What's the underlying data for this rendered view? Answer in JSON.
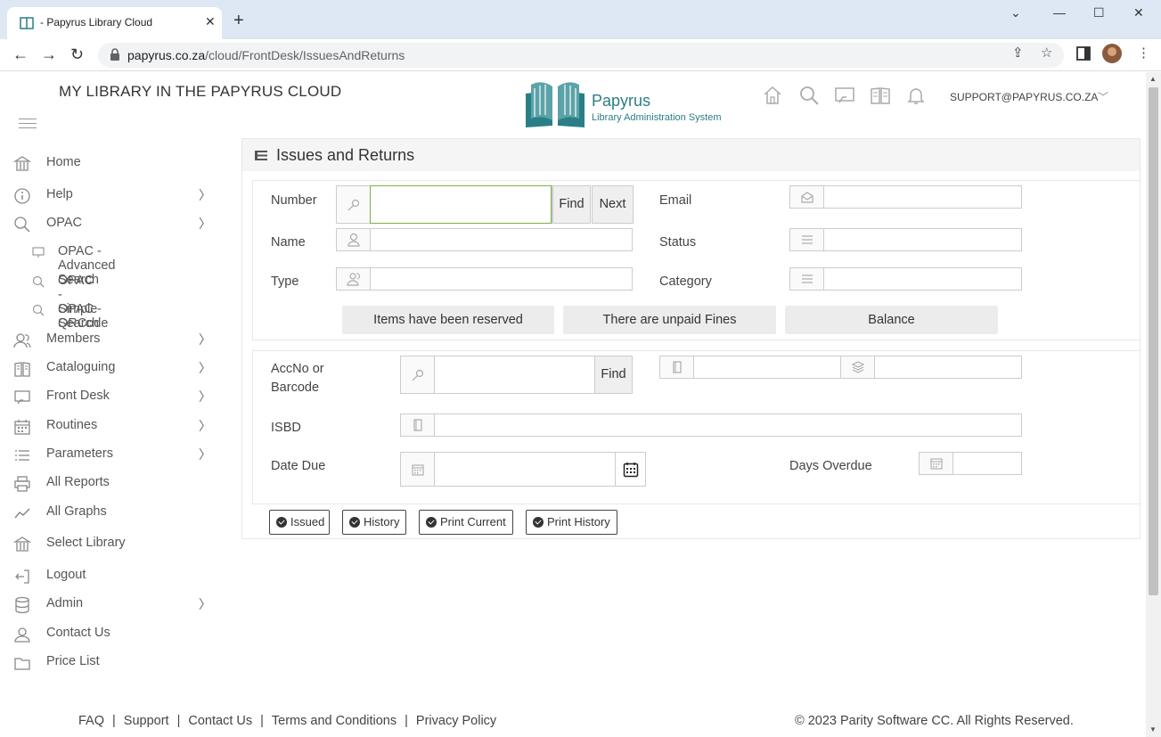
{
  "browser": {
    "tab_title": "- Papyrus Library Cloud",
    "url_host": "papyrus.co.za",
    "url_path": "/cloud/FrontDesk/IssuesAndReturns"
  },
  "header": {
    "site_title": "MY LIBRARY IN THE PAPYRUS CLOUD",
    "brand": "Papyrus",
    "tagline": "Library Administration System",
    "user_email": "SUPPORT@PAPYRUS.CO.ZA"
  },
  "sidebar": {
    "items": [
      {
        "label": "Home",
        "icon": "bank-icon"
      },
      {
        "label": "Help",
        "icon": "info-icon"
      },
      {
        "label": "OPAC",
        "icon": "search-icon"
      },
      {
        "label": "OPAC - Advanced Search",
        "icon": "monitor-icon"
      },
      {
        "label": "OPAC - Simple Search",
        "icon": "search-icon"
      },
      {
        "label": "OPAC - QRCode",
        "icon": "search-icon"
      },
      {
        "label": "Members",
        "icon": "users-icon"
      },
      {
        "label": "Cataloguing",
        "icon": "book-icon"
      },
      {
        "label": "Front Desk",
        "icon": "desk-icon"
      },
      {
        "label": "Routines",
        "icon": "calendar-icon"
      },
      {
        "label": "Parameters",
        "icon": "list-icon"
      },
      {
        "label": "All Reports",
        "icon": "printer-icon"
      },
      {
        "label": "All Graphs",
        "icon": "graph-icon"
      },
      {
        "label": "Select Library",
        "icon": "bank-icon"
      },
      {
        "label": "Logout",
        "icon": "logout-icon"
      },
      {
        "label": "Admin",
        "icon": "database-icon"
      },
      {
        "label": "Contact Us",
        "icon": "user-icon"
      },
      {
        "label": "Price List",
        "icon": "folder-icon"
      }
    ]
  },
  "main": {
    "title": "Issues and Returns",
    "member": {
      "number_label": "Number",
      "number_value": "",
      "find_label": "Find",
      "next_label": "Next",
      "name_label": "Name",
      "type_label": "Type",
      "email_label": "Email",
      "status_label": "Status",
      "category_label": "Category",
      "reserved_btn": "Items have been reserved",
      "fines_btn": "There are unpaid Fines",
      "balance_btn": "Balance"
    },
    "item": {
      "accno_label": "AccNo or Barcode",
      "accno_label_line1": "AccNo or",
      "accno_label_line2": "Barcode",
      "find_label": "Find",
      "isbd_label": "ISBD",
      "date_due_label": "Date Due",
      "days_overdue_label": "Days Overdue"
    },
    "actions": {
      "issued": "Issued",
      "history": "History",
      "print_current": "Print Current",
      "print_history": "Print History"
    }
  },
  "footer": {
    "links": [
      "FAQ",
      "Support",
      "Contact Us",
      "Terms and Conditions",
      "Privacy Policy"
    ],
    "copyright": "© 2023 Parity Software CC. All Rights Reserved."
  },
  "colors": {
    "brand": "#2a7f87",
    "focus_border": "#7cb342",
    "chrome_bg": "#dee7f4"
  }
}
